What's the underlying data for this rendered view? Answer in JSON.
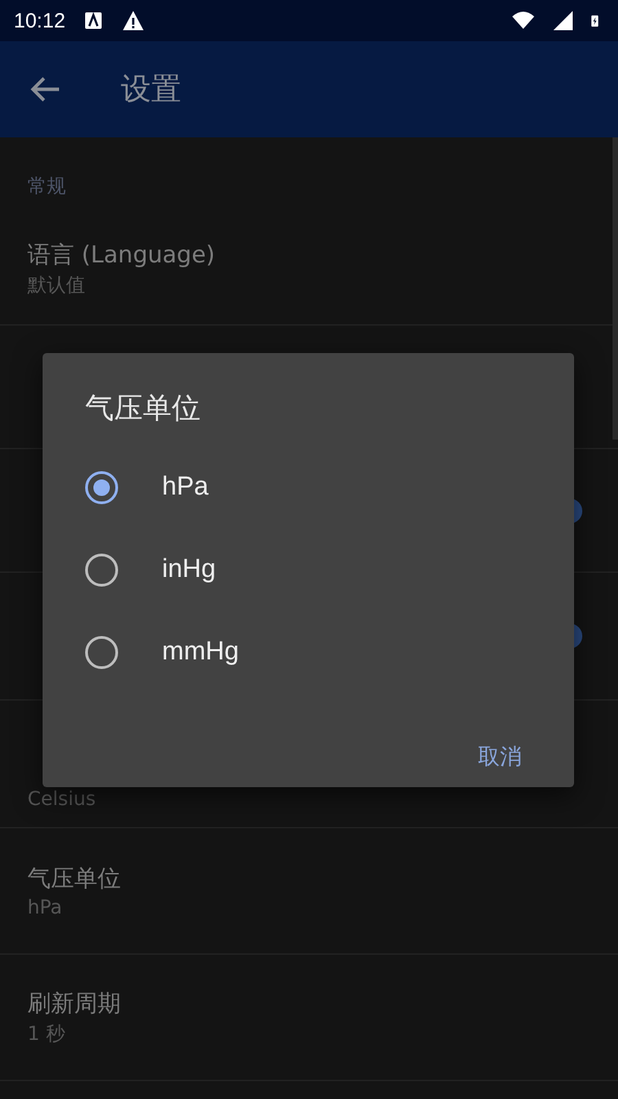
{
  "status_bar": {
    "time": "10:12"
  },
  "app_bar": {
    "title": "设置"
  },
  "section": {
    "title": "常规"
  },
  "rows": [
    {
      "kind": "plain",
      "title": "语言 (Language)",
      "value": "默认值"
    },
    {
      "kind": "plain"
    },
    {
      "kind": "switch",
      "on": true
    },
    {
      "kind": "switch",
      "on": true
    },
    {
      "kind": "plain",
      "value": "Celsius"
    },
    {
      "kind": "plain",
      "title": "气压单位",
      "value": "hPa"
    },
    {
      "kind": "plain",
      "title": "刷新周期",
      "value": "1 秒"
    }
  ],
  "dialog": {
    "title": "气压单位",
    "options": [
      {
        "label": "hPa",
        "selected": true
      },
      {
        "label": "inHg",
        "selected": false
      },
      {
        "label": "mmHg",
        "selected": false
      }
    ],
    "cancel": "取消"
  }
}
